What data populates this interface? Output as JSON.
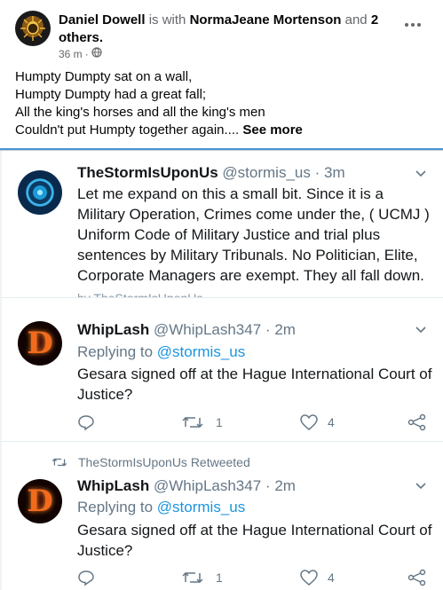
{
  "post": {
    "author": "Daniel Dowell",
    "with_text": "is with",
    "tagged": "NormaJeane Mortenson",
    "and_text": "and",
    "others": "2 others.",
    "time": "36 m",
    "sep": "·",
    "text": "Humpty Dumpty sat on a wall,\nHumpty Dumpty had a great fall;\nAll the king's horses and all the king's men\nCouldn't put Humpty together again....",
    "see_more": "See more"
  },
  "tweets": [
    {
      "name": "TheStormIsUponUs",
      "handle": "@stormis_us",
      "time_sep": "·",
      "time": "3m",
      "body": "Let me expand on this a small bit. Since it is a Military Operation,  Crimes come under the,  ( UCMJ ) Uniform Code of Military Justice and trial plus sentences by Military Tribunals. No Politician, Elite, Corporate Managers are exempt. They all fall down.",
      "cut_text": "by TheStormIsUponUs"
    },
    {
      "name": "WhipLash",
      "handle": "@WhipLash347",
      "time_sep": "·",
      "time": "2m",
      "replying_prefix": "Replying to",
      "replying_to": "@stormis_us",
      "body": "Gesara signed off at the Hague International Court of Justice?",
      "retweets": "1",
      "likes": "4",
      "avatar_letter": "D"
    },
    {
      "retweeted_by": "TheStormIsUponUs Retweeted",
      "name": "WhipLash",
      "handle": "@WhipLash347",
      "time_sep": "·",
      "time": "2m",
      "replying_prefix": "Replying to",
      "replying_to": "@stormis_us",
      "body": "Gesara signed off at the Hague International Court of Justice?",
      "retweets": "1",
      "likes": "4",
      "avatar_letter": "D"
    }
  ],
  "colors": {
    "link_blue": "#1b95e0",
    "muted": "#657786",
    "accent_bar": "#2b80c9"
  },
  "icons": [
    "globe-icon",
    "more-dots-icon",
    "chevron-down-icon",
    "reply-icon",
    "retweet-icon",
    "heart-icon",
    "share-icon"
  ]
}
